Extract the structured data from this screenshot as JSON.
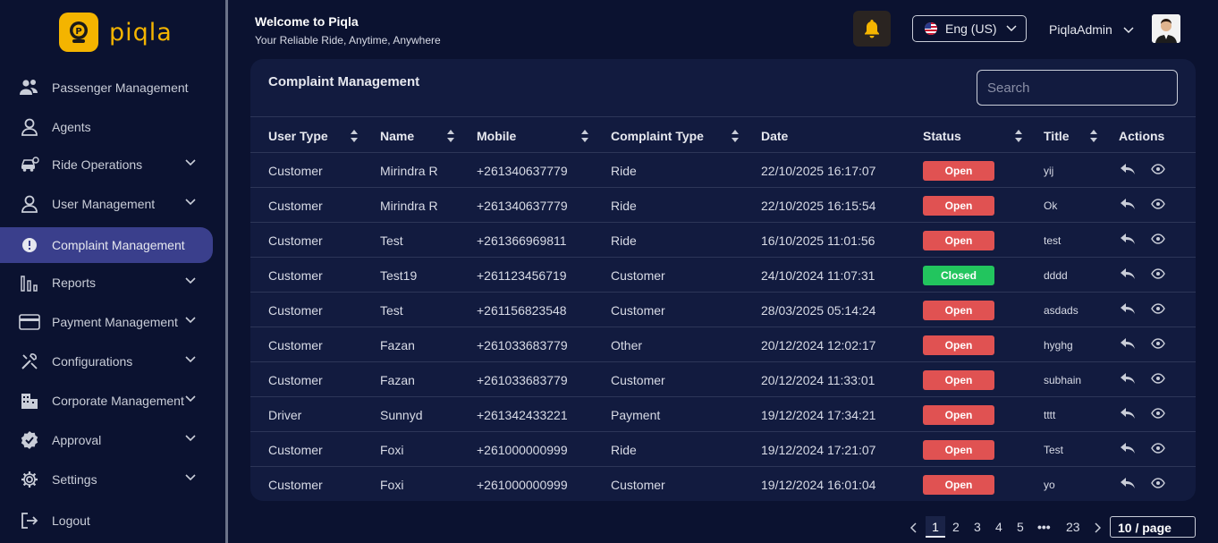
{
  "app": {
    "logo_text": "piqla"
  },
  "header": {
    "welcome_title": "Welcome to Piqla",
    "welcome_subtitle": "Your Reliable Ride, Anytime, Anywhere",
    "language": "Eng (US)",
    "admin_name": "PiqlaAdmin"
  },
  "sidebar": {
    "items": [
      {
        "label": "Passenger Management",
        "icon": "users-icon",
        "chevron": false,
        "active": false
      },
      {
        "label": "Agents",
        "icon": "user-icon",
        "chevron": false,
        "active": false
      },
      {
        "label": "Ride Operations",
        "icon": "car-icon",
        "chevron": true,
        "active": false
      },
      {
        "label": "User Management",
        "icon": "user-icon",
        "chevron": true,
        "active": false
      },
      {
        "label": "Complaint Management",
        "icon": "alert-circle-icon",
        "chevron": false,
        "active": true
      },
      {
        "label": "Reports",
        "icon": "bar-chart-icon",
        "chevron": true,
        "active": false
      },
      {
        "label": "Payment Management",
        "icon": "credit-card-icon",
        "chevron": true,
        "active": false
      },
      {
        "label": "Configurations",
        "icon": "tools-icon",
        "chevron": true,
        "active": false
      },
      {
        "label": "Corporate Management",
        "icon": "building-icon",
        "chevron": true,
        "active": false
      },
      {
        "label": "Approval",
        "icon": "badge-check-icon",
        "chevron": true,
        "active": false
      },
      {
        "label": "Settings",
        "icon": "gear-icon",
        "chevron": true,
        "active": false
      },
      {
        "label": "Logout",
        "icon": "logout-icon",
        "chevron": false,
        "active": false
      }
    ]
  },
  "main": {
    "title": "Complaint Management",
    "search_placeholder": "Search",
    "columns": [
      "User Type",
      "Name",
      "Mobile",
      "Complaint Type",
      "Date",
      "Status",
      "Title",
      "Actions"
    ],
    "rows": [
      {
        "user_type": "Customer",
        "name": "Mirindra R",
        "mobile": "+261340637779",
        "complaint_type": "Ride",
        "date": "22/10/2025 16:17:07",
        "status": "Open",
        "title": "yij"
      },
      {
        "user_type": "Customer",
        "name": "Mirindra R",
        "mobile": "+261340637779",
        "complaint_type": "Ride",
        "date": "22/10/2025 16:15:54",
        "status": "Open",
        "title": "Ok"
      },
      {
        "user_type": "Customer",
        "name": "Test",
        "mobile": "+261366969811",
        "complaint_type": "Ride",
        "date": "16/10/2025 11:01:56",
        "status": "Open",
        "title": "test"
      },
      {
        "user_type": "Customer",
        "name": "Test19",
        "mobile": "+261123456719",
        "complaint_type": "Customer",
        "date": "24/10/2024 11:07:31",
        "status": "Closed",
        "title": "dddd"
      },
      {
        "user_type": "Customer",
        "name": "Test",
        "mobile": "+261156823548",
        "complaint_type": "Customer",
        "date": "28/03/2025 05:14:24",
        "status": "Open",
        "title": "asdads"
      },
      {
        "user_type": "Customer",
        "name": "Fazan",
        "mobile": "+261033683779",
        "complaint_type": "Other",
        "date": "20/12/2024 12:02:17",
        "status": "Open",
        "title": "hyghg"
      },
      {
        "user_type": "Customer",
        "name": "Fazan",
        "mobile": "+261033683779",
        "complaint_type": "Customer",
        "date": "20/12/2024 11:33:01",
        "status": "Open",
        "title": "subhain"
      },
      {
        "user_type": "Driver",
        "name": "Sunnyd",
        "mobile": "+261342433221",
        "complaint_type": "Payment",
        "date": "19/12/2024 17:34:21",
        "status": "Open",
        "title": "tttt"
      },
      {
        "user_type": "Customer",
        "name": "Foxi",
        "mobile": "+261000000999",
        "complaint_type": "Ride",
        "date": "19/12/2024 17:21:07",
        "status": "Open",
        "title": "Test"
      },
      {
        "user_type": "Customer",
        "name": "Foxi",
        "mobile": "+261000000999",
        "complaint_type": "Customer",
        "date": "19/12/2024 16:01:04",
        "status": "Open",
        "title": "yo"
      }
    ]
  },
  "pagination": {
    "pages": [
      "1",
      "2",
      "3",
      "4",
      "5",
      "•••",
      "23"
    ],
    "current": "1",
    "page_size": "10 / page"
  },
  "colors": {
    "background": "#0b1230",
    "panel": "#121b3f",
    "active_nav": "#3a3f8c",
    "status_open": "#e05252",
    "status_closed": "#22c55e",
    "brand": "#f4b400"
  }
}
